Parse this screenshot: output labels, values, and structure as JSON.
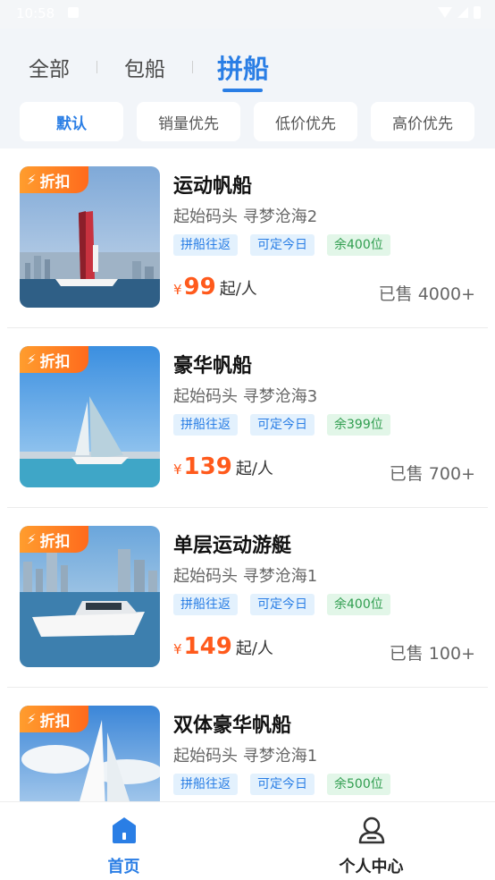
{
  "status": {
    "time": "10:58"
  },
  "tabs": [
    {
      "label": "全部"
    },
    {
      "label": "包船"
    },
    {
      "label": "拼船"
    }
  ],
  "sort": [
    {
      "label": "默认"
    },
    {
      "label": "销量优先"
    },
    {
      "label": "低价优先"
    },
    {
      "label": "高价优先"
    }
  ],
  "items": [
    {
      "badge": "折扣",
      "title": "运动帆船",
      "route": "起始码头 寻梦沧海2",
      "tags": [
        "拼船往返",
        "可定今日",
        "余400位"
      ],
      "currency": "¥",
      "price": "99",
      "unit": "起/人",
      "sold": "已售 4000+"
    },
    {
      "badge": "折扣",
      "title": "豪华帆船",
      "route": "起始码头 寻梦沧海3",
      "tags": [
        "拼船往返",
        "可定今日",
        "余399位"
      ],
      "currency": "¥",
      "price": "139",
      "unit": "起/人",
      "sold": "已售 700+"
    },
    {
      "badge": "折扣",
      "title": "单层运动游艇",
      "route": "起始码头 寻梦沧海1",
      "tags": [
        "拼船往返",
        "可定今日",
        "余400位"
      ],
      "currency": "¥",
      "price": "149",
      "unit": "起/人",
      "sold": "已售 100+"
    },
    {
      "badge": "折扣",
      "title": "双体豪华帆船",
      "route": "起始码头 寻梦沧海1",
      "tags": [
        "拼船往返",
        "可定今日",
        "余500位"
      ],
      "currency": "¥",
      "price": "",
      "unit": "",
      "sold": ""
    }
  ],
  "nav": [
    {
      "label": "首页",
      "icon": "home-icon"
    },
    {
      "label": "个人中心",
      "icon": "user-icon"
    }
  ],
  "colors": {
    "accent": "#2a7ee5",
    "price": "#ff5a1c",
    "badge": "#ff7a22",
    "tag_green": "#2f9d4e"
  }
}
